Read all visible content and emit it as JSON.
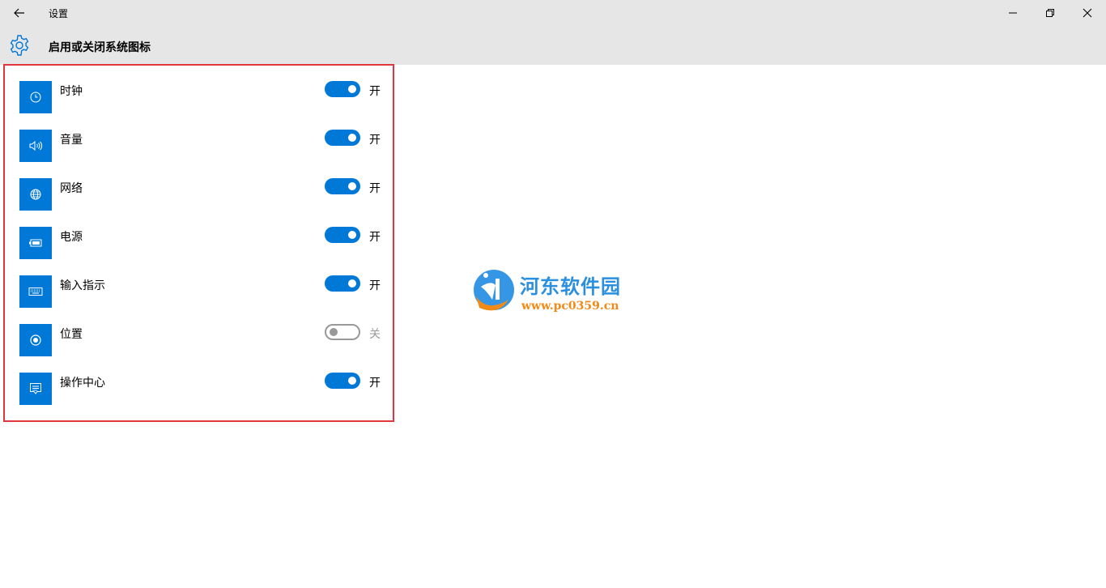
{
  "window": {
    "title": "设置"
  },
  "header": {
    "title": "启用或关闭系统图标"
  },
  "items": [
    {
      "label": "时钟",
      "state": "开",
      "on": true,
      "icon": "clock-icon"
    },
    {
      "label": "音量",
      "state": "开",
      "on": true,
      "icon": "volume-icon"
    },
    {
      "label": "网络",
      "state": "开",
      "on": true,
      "icon": "globe-icon"
    },
    {
      "label": "电源",
      "state": "开",
      "on": true,
      "icon": "battery-icon"
    },
    {
      "label": "输入指示",
      "state": "开",
      "on": true,
      "icon": "keyboard-icon"
    },
    {
      "label": "位置",
      "state": "关",
      "on": false,
      "icon": "location-icon"
    },
    {
      "label": "操作中心",
      "state": "开",
      "on": true,
      "icon": "action-center-icon"
    }
  ],
  "watermark": {
    "name": "河东软件园",
    "url": "www.pc0359.cn"
  },
  "colors": {
    "accent": "#0078d7",
    "highlight_border": "#e2363f",
    "chrome_bg": "#e6e6e6"
  }
}
